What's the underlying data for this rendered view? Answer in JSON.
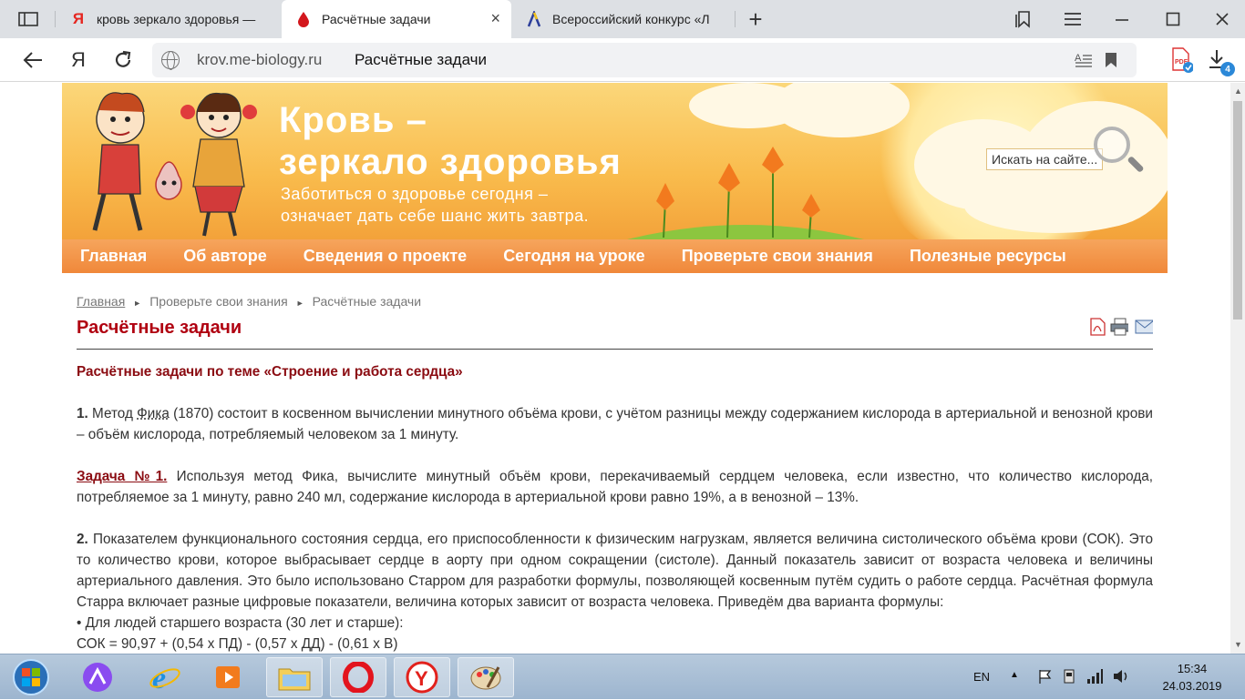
{
  "browser": {
    "tabs": [
      {
        "title": "кровь зеркало здоровья —",
        "favicon": "yandex-y-icon",
        "active": false
      },
      {
        "title": "Расчётные задачи",
        "favicon": "blood-drop-icon",
        "active": true,
        "close": "×"
      },
      {
        "title": "Всероссийский конкурс «Л",
        "favicon": "yandex-lyceum-icon",
        "active": false
      }
    ],
    "new_tab": "+",
    "address": {
      "domain": "krov.me-biology.ru",
      "page_title": "Расчётные задачи"
    },
    "download_badge": "4",
    "pdf_label": "PDF"
  },
  "site": {
    "logo_line1": "Кровь –",
    "logo_line2": "зеркало здоровья",
    "tagline1": "Заботиться о здоровье сегодня –",
    "tagline2": "означает дать себе шанс жить завтра.",
    "search_value": "Искать на сайте...",
    "menu": [
      "Главная",
      "Об авторе",
      "Сведения о проекте",
      "Сегодня на уроке",
      "Проверьте свои знания",
      "Полезные ресурсы"
    ],
    "breadcrumb": [
      "Главная",
      "Проверьте свои знания",
      "Расчётные задачи"
    ],
    "page_title": "Расчётные задачи"
  },
  "article": {
    "subtitle": "Расчётные задачи по теме «Строение и работа сердца»",
    "p1_num": "1.",
    "p1_a": " Метод ",
    "p1_link": "Фика",
    "p1_b": " (1870) состоит в косвенном вычислении минутного объёма крови, с учётом разницы между содержанием кислорода в артериальной и венозной крови – объём кислорода, потребляемый человеком за 1 минуту.",
    "task1_label": "Задача №1.",
    "task1_text": " Используя метод Фика, вычислите минутный объём крови, перекачиваемый сердцем человека, если известно, что количество кислорода, потребляемое за 1 минуту, равно 240 мл, содержание кислорода в артериальной крови равно 19%, а в венозной – 13%.",
    "p2_num": "2.",
    "p2_text": " Показателем функционального состояния сердца, его приспособленности к физическим нагрузкам, является величина систолического объёма крови (СОК). Это то количество крови, которое выбрасывает сердце в аорту при одном сокращении (систоле). Данный показатель зависит от возраста человека и величины артериального давления. Это было использовано Старром для разработки формулы, позволяющей косвенным путём судить о работе сердца. Расчётная формула Старра включает разные цифровые показатели, величина которых зависит от возраста человека. Приведём два варианта формулы:",
    "bullet1": "• Для людей старшего возраста (30 лет и старше):",
    "formula1": "СОК = 90,97 + (0,54 х ПД) - (0,57 х ДД) - (0,61 х В)"
  },
  "taskbar": {
    "lang": "EN",
    "time": "15:34",
    "date": "24.03.2019"
  }
}
